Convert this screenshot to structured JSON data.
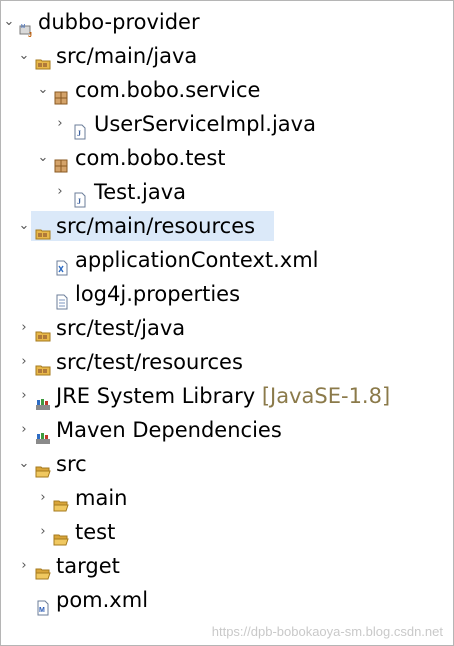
{
  "tree": [
    {
      "label": "dubbo-provider",
      "icon": "maven-project-icon",
      "chevron": "expanded"
    },
    {
      "label": "src/main/java",
      "icon": "source-folder-icon",
      "chevron": "expanded"
    },
    {
      "label": "com.bobo.service",
      "icon": "package-icon",
      "chevron": "expanded"
    },
    {
      "label": "UserServiceImpl.java",
      "icon": "java-file-icon",
      "chevron": "collapsed"
    },
    {
      "label": "com.bobo.test",
      "icon": "package-icon",
      "chevron": "expanded"
    },
    {
      "label": "Test.java",
      "icon": "java-file-icon",
      "chevron": "collapsed"
    },
    {
      "label": "src/main/resources",
      "icon": "source-folder-icon",
      "chevron": "expanded",
      "selected": true
    },
    {
      "label": "applicationContext.xml",
      "icon": "xml-file-icon",
      "chevron": "none"
    },
    {
      "label": "log4j.properties",
      "icon": "text-file-icon",
      "chevron": "none"
    },
    {
      "label": "src/test/java",
      "icon": "source-folder-icon",
      "chevron": "collapsed"
    },
    {
      "label": "src/test/resources",
      "icon": "source-folder-icon",
      "chevron": "collapsed"
    },
    {
      "label": "JRE System Library",
      "suffix": "[JavaSE-1.8]",
      "icon": "library-icon",
      "chevron": "collapsed"
    },
    {
      "label": "Maven Dependencies",
      "icon": "library-icon",
      "chevron": "collapsed"
    },
    {
      "label": "src",
      "icon": "folder-icon",
      "chevron": "expanded"
    },
    {
      "label": "main",
      "icon": "folder-icon",
      "chevron": "collapsed"
    },
    {
      "label": "test",
      "icon": "folder-icon",
      "chevron": "collapsed"
    },
    {
      "label": "target",
      "icon": "folder-icon",
      "chevron": "collapsed"
    },
    {
      "label": "pom.xml",
      "icon": "maven-pom-icon",
      "chevron": "none"
    }
  ],
  "watermark": "https://dpb-bobokaoya-sm.blog.csdn.net",
  "colors": {
    "selection": "#dbe9f9",
    "suffix": "#8b7a4a",
    "folder": "#e8b84a",
    "package": "#b07a3a"
  }
}
